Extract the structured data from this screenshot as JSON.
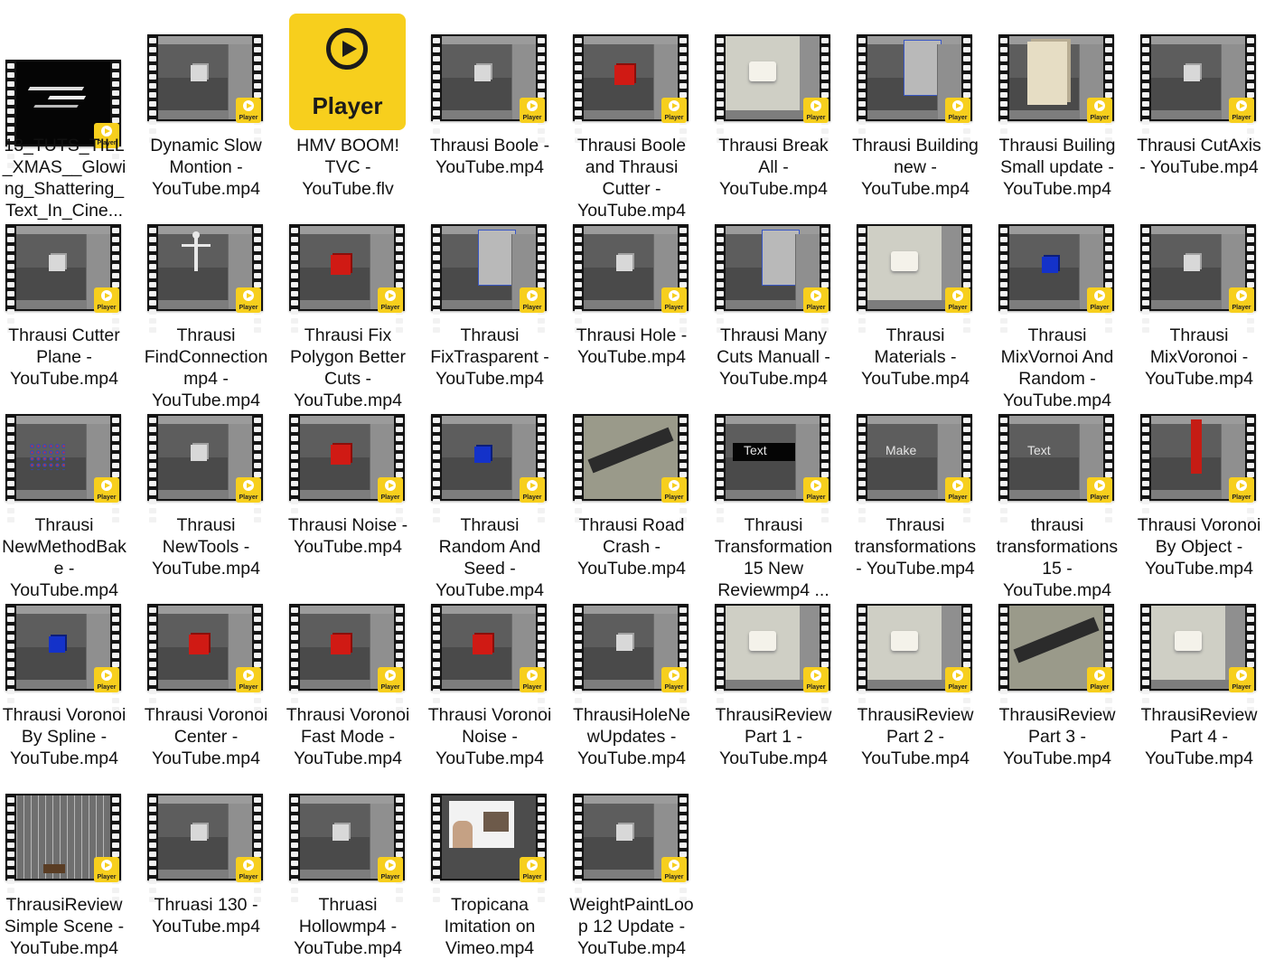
{
  "files": [
    {
      "name": "13_TUTS_TILL_XMAS__Glowing_Shattering_Text_In_Cine...",
      "kind": "video",
      "scene": "dark",
      "badge": "Player"
    },
    {
      "name": "Dynamic Slow Montion - YouTube.mp4",
      "kind": "video",
      "scene": "c4d",
      "badge": "Player"
    },
    {
      "name": "HMV BOOM! TVC - YouTube.flv",
      "kind": "app-icon",
      "icon": "play-icon",
      "icon_label": "Player"
    },
    {
      "name": "Thrausi Boole - YouTube.mp4",
      "kind": "video",
      "scene": "c4d",
      "badge": "Player"
    },
    {
      "name": "Thrausi Boole and Thrausi Cutter - YouTube.mp4",
      "kind": "video",
      "scene": "c4d-red",
      "badge": "Player"
    },
    {
      "name": "Thrausi Break All - YouTube.mp4",
      "kind": "video",
      "scene": "c4d-light",
      "badge": "Player"
    },
    {
      "name": "Thrausi Building new - YouTube.mp4",
      "kind": "video",
      "scene": "c4d-panel",
      "badge": "Player"
    },
    {
      "name": "Thrausi Builing Small update - YouTube.mp4",
      "kind": "video",
      "scene": "c4d-building",
      "badge": "Player"
    },
    {
      "name": "Thrausi CutAxis - YouTube.mp4",
      "kind": "video",
      "scene": "c4d",
      "badge": "Player"
    },
    {
      "name": "Thrausi Cutter Plane - YouTube.mp4",
      "kind": "video",
      "scene": "c4d",
      "badge": "Player"
    },
    {
      "name": "Thrausi FindConnectionmp4 - YouTube.mp4",
      "kind": "video",
      "scene": "c4d-figure",
      "badge": "Player"
    },
    {
      "name": "Thrausi Fix Polygon Better Cuts - YouTube.mp4",
      "kind": "video",
      "scene": "c4d-red",
      "badge": "Player"
    },
    {
      "name": "Thrausi FixTrasparent - YouTube.mp4",
      "kind": "video",
      "scene": "c4d-panel",
      "badge": "Player"
    },
    {
      "name": "Thrausi Hole - YouTube.mp4",
      "kind": "video",
      "scene": "c4d",
      "badge": "Player"
    },
    {
      "name": "Thrausi Many Cuts Manuall - YouTube.mp4",
      "kind": "video",
      "scene": "c4d-panel",
      "badge": "Player"
    },
    {
      "name": "Thrausi Materials - YouTube.mp4",
      "kind": "video",
      "scene": "c4d-light",
      "badge": "Player"
    },
    {
      "name": "Thrausi MixVornoi And Random - YouTube.mp4",
      "kind": "video",
      "scene": "c4d-blue",
      "badge": "Player"
    },
    {
      "name": "Thrausi MixVoronoi - YouTube.mp4",
      "kind": "video",
      "scene": "c4d",
      "badge": "Player"
    },
    {
      "name": "Thrausi NewMethodBake - YouTube.mp4",
      "kind": "video",
      "scene": "c4d-particles",
      "badge": "Player"
    },
    {
      "name": "Thrausi NewTools - YouTube.mp4",
      "kind": "video",
      "scene": "c4d",
      "badge": "Player"
    },
    {
      "name": "Thrausi Noise - YouTube.mp4",
      "kind": "video",
      "scene": "c4d-red",
      "badge": "Player"
    },
    {
      "name": "Thrausi Random And Seed - YouTube.mp4",
      "kind": "video",
      "scene": "c4d-blue",
      "badge": "Player"
    },
    {
      "name": "Thrausi Road Crash - YouTube.mp4",
      "kind": "video",
      "scene": "c4d-road",
      "badge": "Player"
    },
    {
      "name": "Thrausi Transformation 15 New Reviewmp4 ...",
      "kind": "video",
      "scene": "c4d-text-dark",
      "badge": "Player",
      "overlay_text": "Text"
    },
    {
      "name": "Thrausi transformations - YouTube.mp4",
      "kind": "video",
      "scene": "c4d-text",
      "badge": "Player",
      "overlay_text": "Make"
    },
    {
      "name": "thrausi transformations 15 - YouTube.mp4",
      "kind": "video",
      "scene": "c4d-text",
      "badge": "Player",
      "overlay_text": "Text"
    },
    {
      "name": "Thrausi Voronoi By Object - YouTube.mp4",
      "kind": "video",
      "scene": "c4d-redbar",
      "badge": "Player"
    },
    {
      "name": "Thrausi Voronoi By Spline - YouTube.mp4",
      "kind": "video",
      "scene": "c4d-blue",
      "badge": "Player"
    },
    {
      "name": "Thrausi Voronoi Center - YouTube.mp4",
      "kind": "video",
      "scene": "c4d-red",
      "badge": "Player"
    },
    {
      "name": "Thrausi Voronoi Fast Mode - YouTube.mp4",
      "kind": "video",
      "scene": "c4d-red",
      "badge": "Player"
    },
    {
      "name": "Thrausi Voronoi Noise - YouTube.mp4",
      "kind": "video",
      "scene": "c4d-red",
      "badge": "Player"
    },
    {
      "name": "ThrausiHoleNewUpdates - YouTube.mp4",
      "kind": "video",
      "scene": "c4d",
      "badge": "Player"
    },
    {
      "name": "ThrausiReview Part 1 - YouTube.mp4",
      "kind": "video",
      "scene": "c4d-light",
      "badge": "Player"
    },
    {
      "name": "ThrausiReview Part 2 - YouTube.mp4",
      "kind": "video",
      "scene": "c4d-light",
      "badge": "Player"
    },
    {
      "name": "ThrausiReview Part 3 - YouTube.mp4",
      "kind": "video",
      "scene": "c4d-road",
      "badge": "Player"
    },
    {
      "name": "ThrausiReview Part 4 - YouTube.mp4",
      "kind": "video",
      "scene": "c4d-light",
      "badge": "Player"
    },
    {
      "name": "ThrausiReview Simple Scene - YouTube.mp4",
      "kind": "video",
      "scene": "c4d-grid",
      "badge": "Player"
    },
    {
      "name": "Thruasi 130 - YouTube.mp4",
      "kind": "video",
      "scene": "c4d",
      "badge": "Player"
    },
    {
      "name": "Thruasi Hollowmp4 - YouTube.mp4",
      "kind": "video",
      "scene": "c4d",
      "badge": "Player"
    },
    {
      "name": "Tropicana Imitation on Vimeo.mp4",
      "kind": "video",
      "scene": "webcam",
      "badge": "Player"
    },
    {
      "name": "WeightPaintLoop 12 Update - YouTube.mp4",
      "kind": "video",
      "scene": "c4d",
      "badge": "Player"
    }
  ],
  "colors": {
    "badge": "#f7cf1d",
    "film": "#141414",
    "text": "#111111"
  }
}
